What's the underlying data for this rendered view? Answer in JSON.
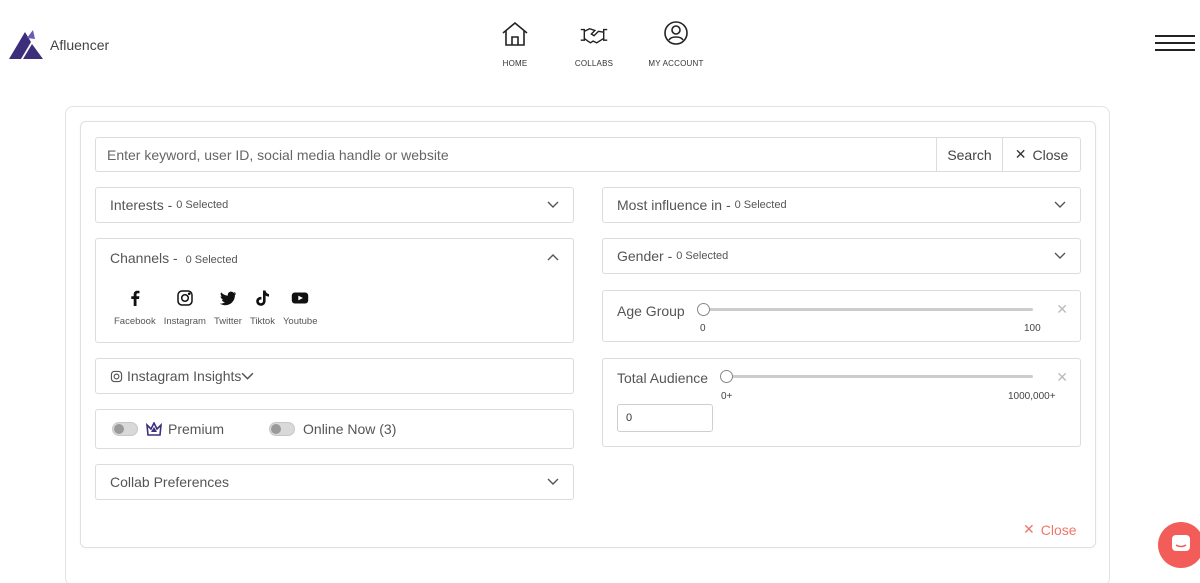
{
  "brand": {
    "name": "Afluencer",
    "logo_color": "#3d2e7c"
  },
  "nav": [
    {
      "label": "HOME",
      "icon": "home-icon"
    },
    {
      "label": "COLLABS",
      "icon": "handshake-icon"
    },
    {
      "label": "MY ACCOUNT",
      "icon": "user-circle-icon"
    }
  ],
  "search": {
    "placeholder": "Enter keyword, user ID, social media handle or website",
    "value": "",
    "search_label": "Search",
    "close_label": "Close"
  },
  "filters": {
    "interests": {
      "label": "Interests -",
      "count": "0 Selected"
    },
    "channels": {
      "label": "Channels -",
      "count": "0 Selected",
      "items": [
        {
          "label": "Facebook",
          "icon": "facebook-icon"
        },
        {
          "label": "Instagram",
          "icon": "instagram-icon"
        },
        {
          "label": "Twitter",
          "icon": "twitter-icon"
        },
        {
          "label": "Tiktok",
          "icon": "tiktok-icon"
        },
        {
          "label": "Youtube",
          "icon": "youtube-icon"
        }
      ]
    },
    "instagram_insights": {
      "label": "Instagram Insights"
    },
    "premium": {
      "label": "Premium",
      "on": false
    },
    "online_now": {
      "label": "Online Now (3)",
      "on": false
    },
    "collab_preferences": {
      "label": "Collab Preferences"
    },
    "most_influence": {
      "label": "Most influence in -",
      "count": "0 Selected"
    },
    "gender": {
      "label": "Gender -",
      "count": "0 Selected"
    },
    "age_group": {
      "label": "Age Group",
      "min": "0",
      "max": "100",
      "value": 0
    },
    "total_audience": {
      "label": "Total Audience",
      "min": "0+",
      "max": "1000,000+",
      "value": 0,
      "input_value": "0"
    }
  },
  "footer": {
    "close_label": "Close"
  },
  "colors": {
    "accent_close": "#f0766b",
    "chat": "#f25d59"
  }
}
